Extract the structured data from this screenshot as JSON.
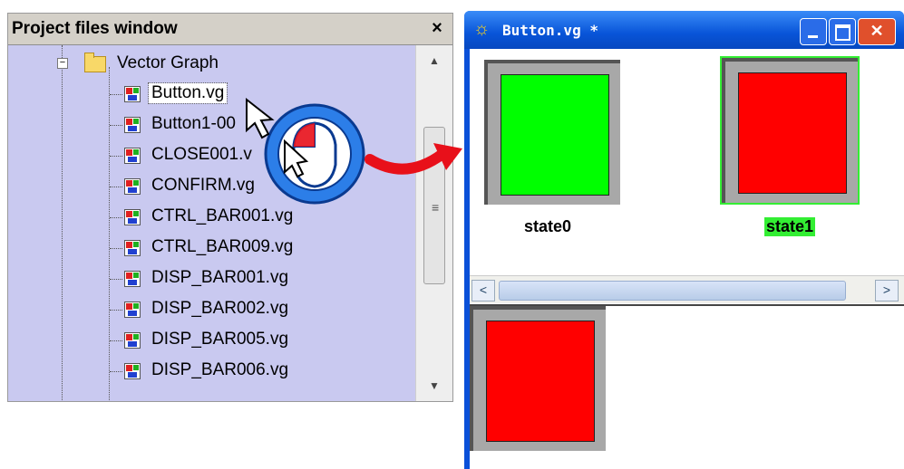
{
  "project_panel": {
    "title": "Project files window",
    "close_label": "×",
    "folder": {
      "expander": "−",
      "label": "Vector Graph"
    },
    "files": [
      {
        "label": "Button.vg",
        "selected": true
      },
      {
        "label": "Button1-00"
      },
      {
        "label": "CLOSE001.v"
      },
      {
        "label": "CONFIRM.vg"
      },
      {
        "label": "CTRL_BAR001.vg"
      },
      {
        "label": "CTRL_BAR009.vg"
      },
      {
        "label": "DISP_BAR001.vg"
      },
      {
        "label": "DISP_BAR002.vg"
      },
      {
        "label": "DISP_BAR005.vg"
      },
      {
        "label": "DISP_BAR006.vg"
      }
    ],
    "scroll_up": "▲",
    "scroll_down": "▼",
    "scroll_grip": "≡"
  },
  "editor_window": {
    "title": "Button.vg *",
    "gear_icon": "☼",
    "close_label": "✕",
    "states": [
      {
        "label": "state0",
        "fill": "#00ff00",
        "selected": false
      },
      {
        "label": "state1",
        "fill": "#ff0000",
        "selected": true
      }
    ],
    "scroll_left": "<",
    "scroll_right": ">",
    "preview_fill": "#ff0000",
    "label_highlight": "#33ee33"
  },
  "colors": {
    "arrow": "#e8101a",
    "cursor_circle": "#2c7ee8",
    "panel_bg": "#c9c9f0"
  }
}
